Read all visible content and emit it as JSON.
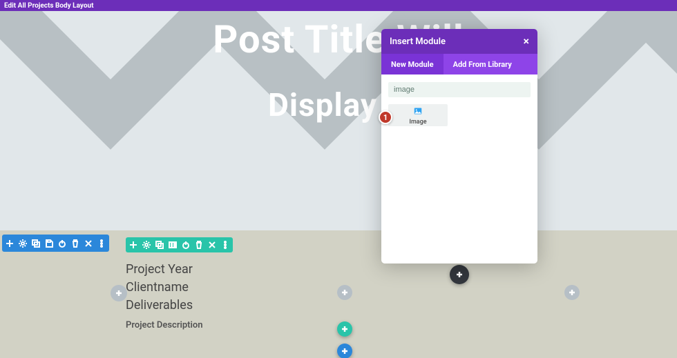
{
  "topbar": {
    "title": "Edit All Projects Body Layout"
  },
  "hero": {
    "title": "Post Title Will",
    "subtitle": "Display H"
  },
  "section_toolbar": {
    "items": [
      "add",
      "settings",
      "duplicate",
      "save",
      "power",
      "delete",
      "close",
      "more"
    ]
  },
  "row_toolbar": {
    "items": [
      "add",
      "settings",
      "duplicate",
      "columns",
      "power",
      "delete",
      "close",
      "more"
    ]
  },
  "project_meta": {
    "lines": [
      "Project Year",
      "Clientname",
      "Deliverables"
    ],
    "description": "Project Description"
  },
  "modal": {
    "title": "Insert Module",
    "tabs": {
      "new": "New Module",
      "library": "Add From Library"
    },
    "active_tab": "new",
    "search_value": "image",
    "result": {
      "label": "Image"
    },
    "badge": "1"
  }
}
